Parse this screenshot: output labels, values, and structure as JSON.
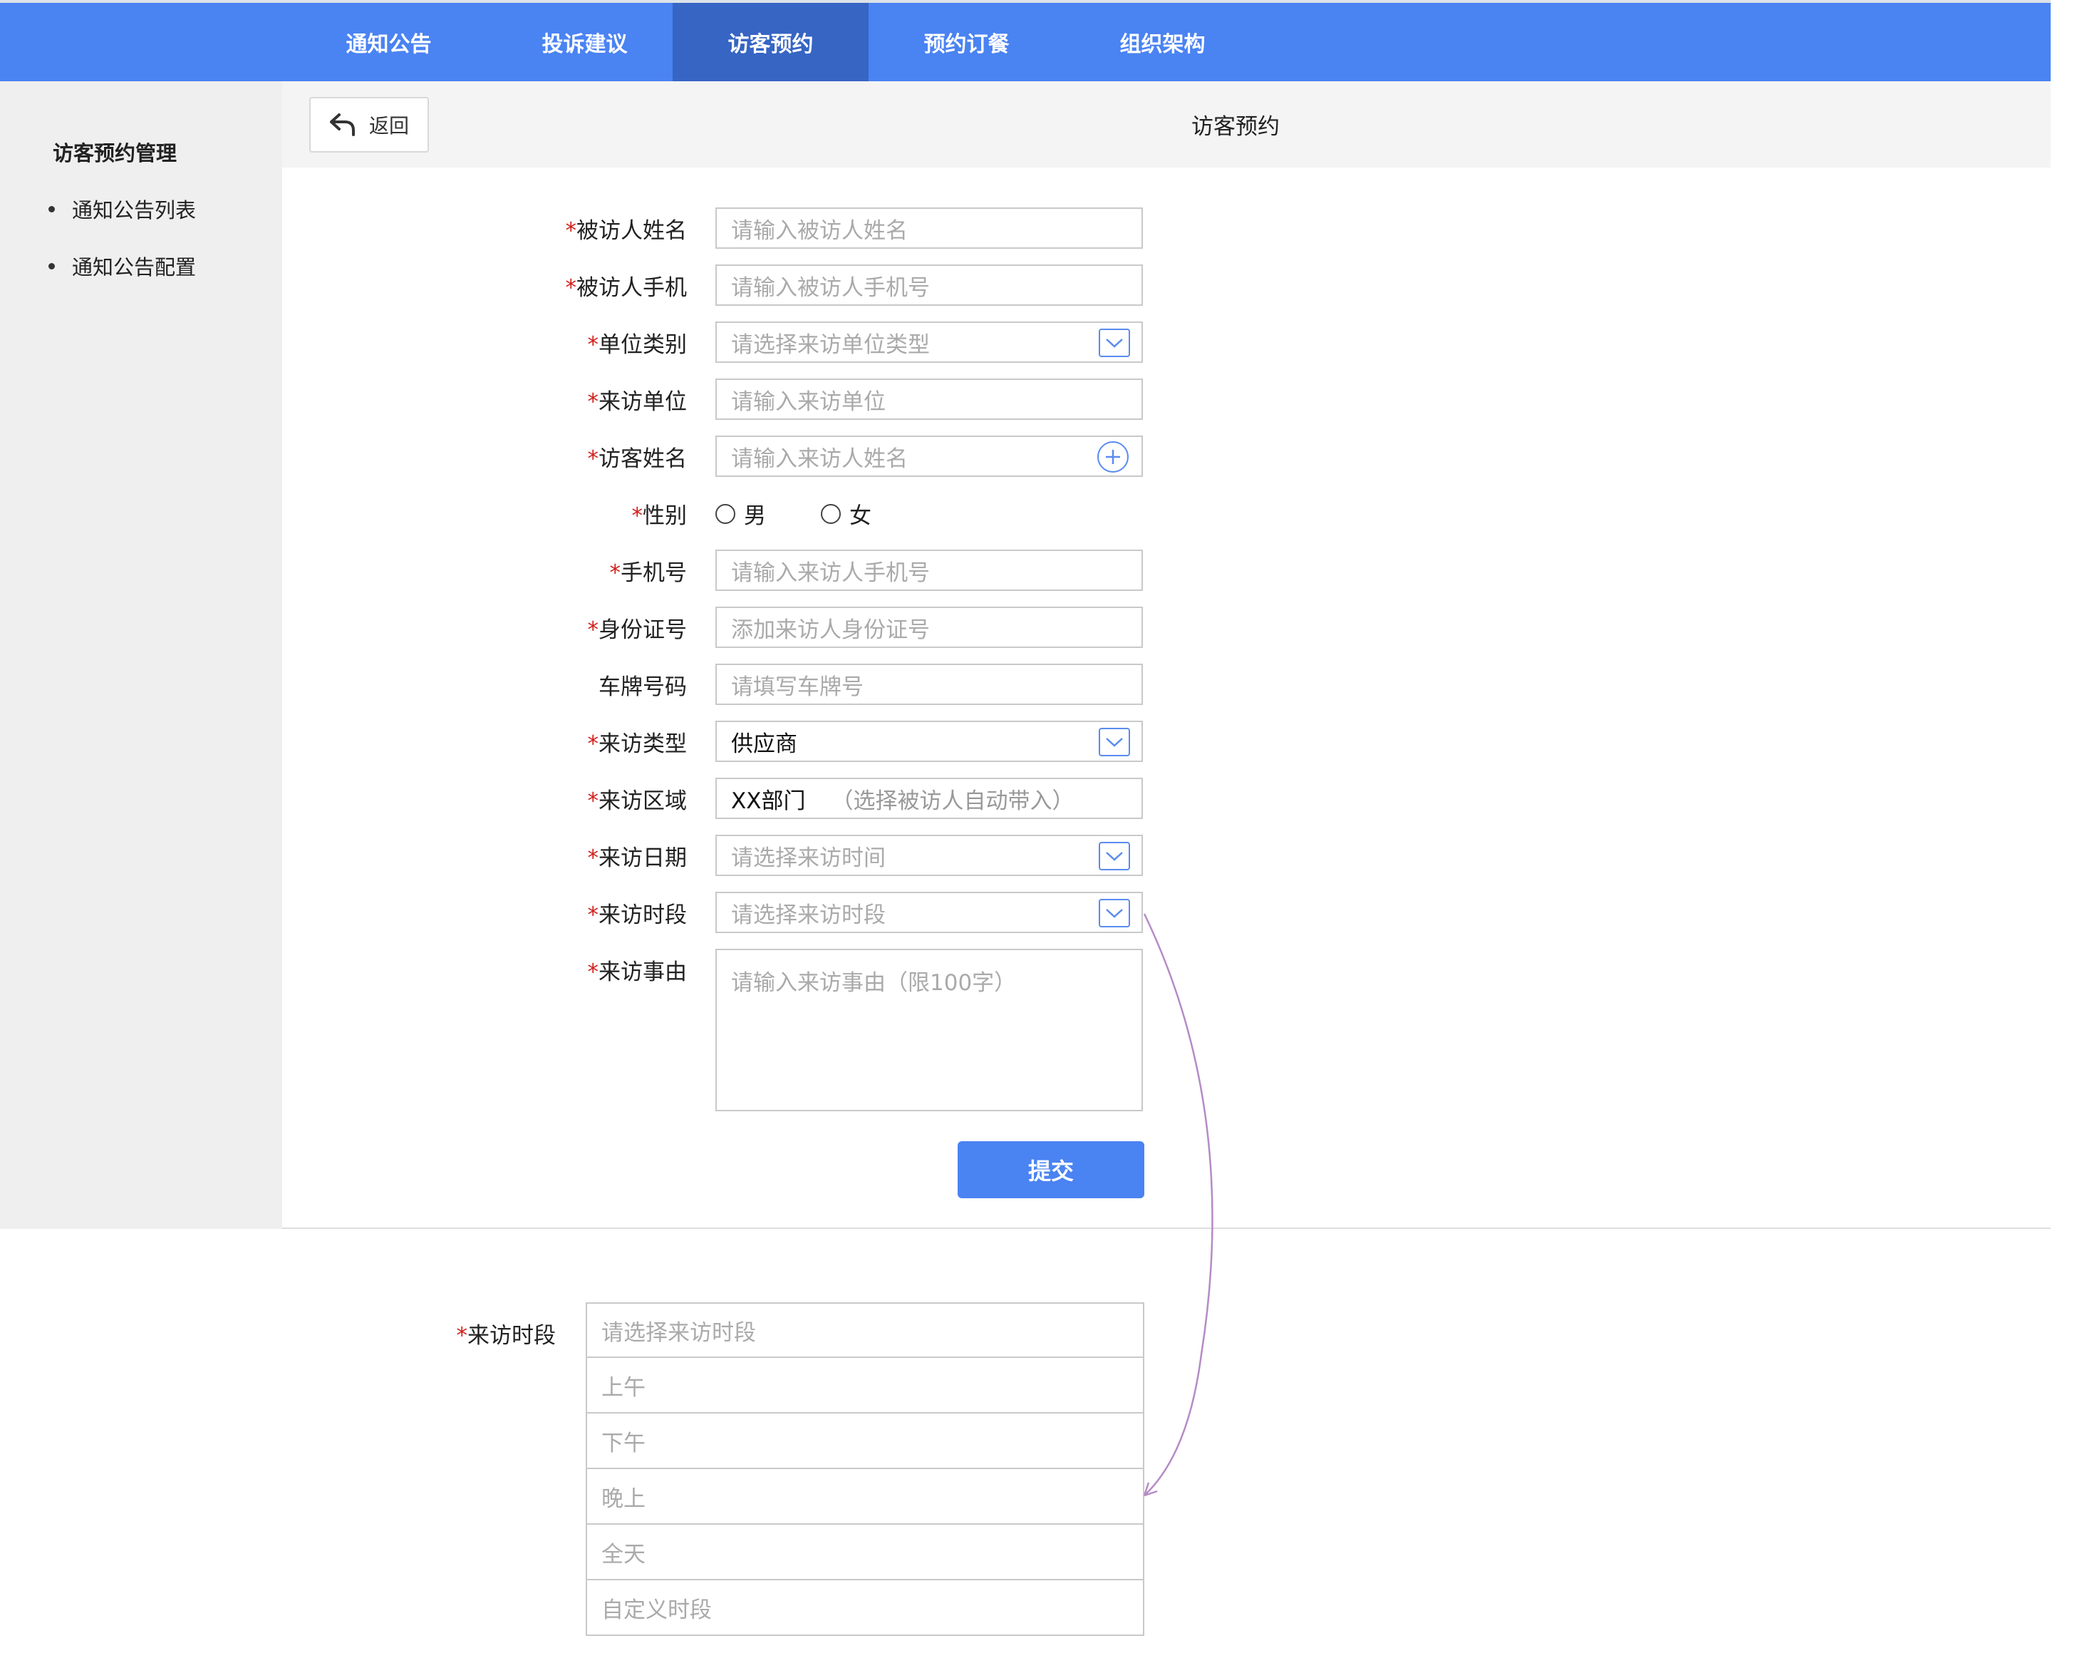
{
  "nav": {
    "tabs": [
      {
        "label": "通知公告"
      },
      {
        "label": "投诉建议"
      },
      {
        "label": "访客预约"
      },
      {
        "label": "预约订餐"
      },
      {
        "label": "组织架构"
      }
    ],
    "active_index": 2
  },
  "sidebar": {
    "title": "访客预约管理",
    "items": [
      {
        "label": "通知公告列表"
      },
      {
        "label": "通知公告配置"
      }
    ]
  },
  "header": {
    "back_label": "返回",
    "title": "访客预约"
  },
  "form": {
    "required_mark": "*",
    "host_name": {
      "label": "被访人姓名",
      "placeholder": "请输入被访人姓名"
    },
    "host_phone": {
      "label": "被访人手机",
      "placeholder": "请输入被访人手机号"
    },
    "unit_type": {
      "label": "单位类别",
      "placeholder": "请选择来访单位类型"
    },
    "visitor_unit": {
      "label": "来访单位",
      "placeholder": "请输入来访单位"
    },
    "visitor_name": {
      "label": "访客姓名",
      "placeholder": "请输入来访人姓名"
    },
    "gender": {
      "label": "性别",
      "options": [
        "男",
        "女"
      ]
    },
    "phone": {
      "label": "手机号",
      "placeholder": "请输入来访人手机号"
    },
    "id_number": {
      "label": "身份证号",
      "placeholder": "添加来访人身份证号"
    },
    "plate": {
      "label": "车牌号码",
      "placeholder": "请填写车牌号"
    },
    "visit_type": {
      "label": "来访类型",
      "value": "供应商"
    },
    "visit_area": {
      "label": "来访区域",
      "value": "XX部门",
      "hint": "（选择被访人自动带入）"
    },
    "visit_date": {
      "label": "来访日期",
      "placeholder": "请选择来访时间"
    },
    "visit_period": {
      "label": "来访时段",
      "placeholder": "请选择来访时段"
    },
    "reason": {
      "label": "来访事由",
      "placeholder": "请输入来访事由（限100字）"
    },
    "submit_label": "提交"
  },
  "period_dropdown": {
    "label": "来访时段",
    "options": [
      "请选择来访时段",
      "上午",
      "下午",
      "晚上",
      "全天",
      "自定义时段"
    ]
  },
  "colors": {
    "nav_bg": "#4a83f2",
    "nav_active": "#3665c4",
    "required": "#d2201b",
    "annotation_arrow": "#b58bc6"
  },
  "icons": {
    "back": "back-arrow-icon",
    "dropdown": "chevron-down-icon",
    "add": "plus-circle-icon"
  }
}
